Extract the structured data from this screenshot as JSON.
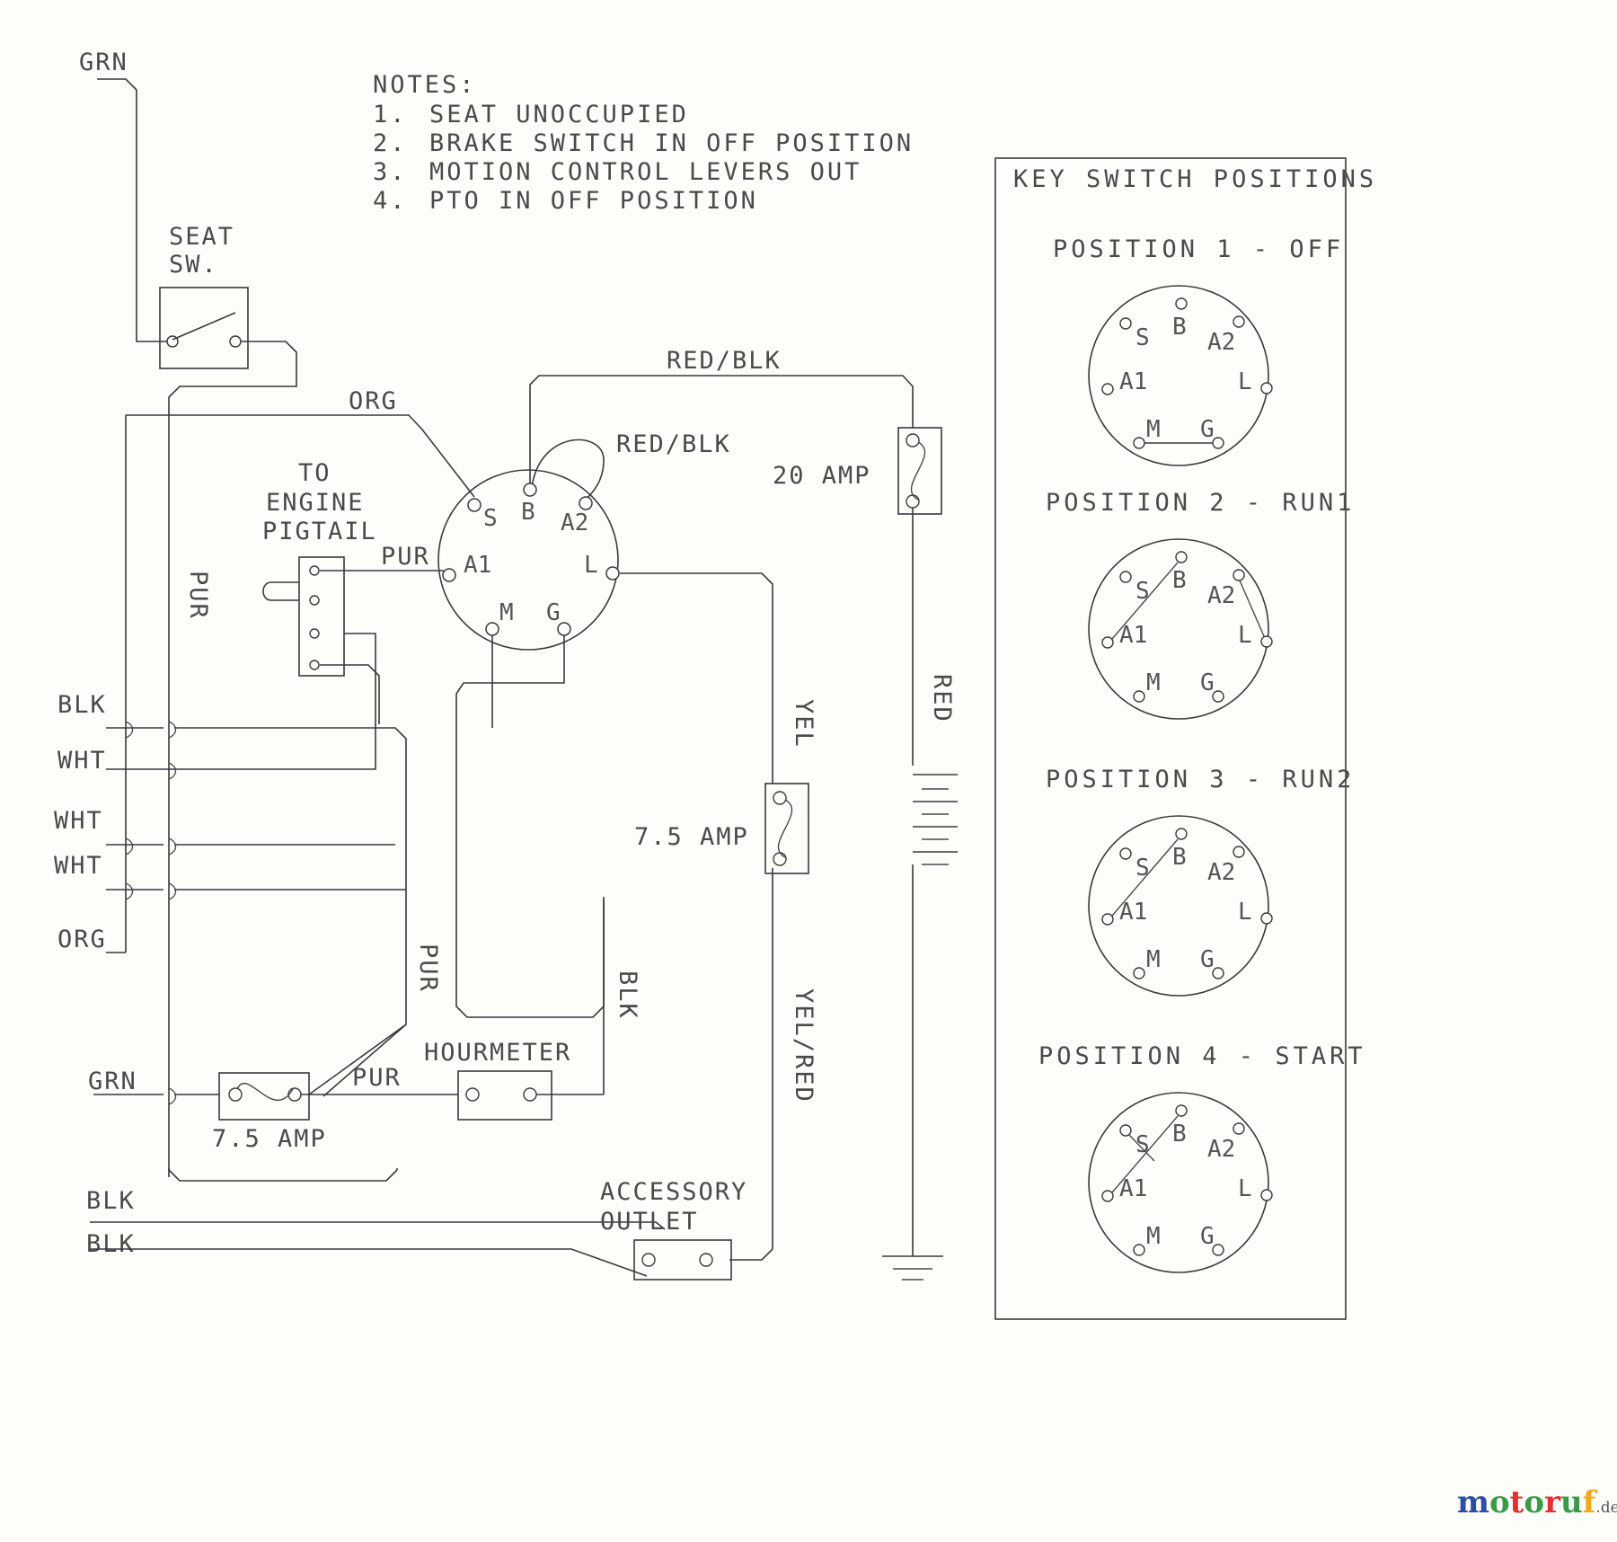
{
  "diagram": {
    "title": "Riding mower electrical wiring diagram",
    "notes": {
      "heading": "NOTES:",
      "items": [
        {
          "num": "1.",
          "text": "SEAT UNOCCUPIED"
        },
        {
          "num": "2.",
          "text": "BRAKE SWITCH IN OFF POSITION"
        },
        {
          "num": "3.",
          "text": "MOTION CONTROL LEVERS OUT"
        },
        {
          "num": "4.",
          "text": "PTO IN OFF POSITION"
        }
      ]
    },
    "components": {
      "seat_switch": "SEAT\nSW.",
      "seat_switch_line1": "SEAT",
      "seat_switch_line2": "SW.",
      "engine_pigtail_line1": "TO",
      "engine_pigtail_line2": "ENGINE",
      "engine_pigtail_line3": "PIGTAIL",
      "fuse_20amp": "20 AMP",
      "fuse_75amp_right": "7.5 AMP",
      "fuse_75amp_bottom": "7.5  AMP",
      "hourmeter": "HOURMETER",
      "accessory_outlet_line1": "ACCESSORY",
      "accessory_outlet_line2": "OUTLET"
    },
    "ignition_terminals": [
      "S",
      "B",
      "A2",
      "A1",
      "L",
      "M",
      "G"
    ],
    "wire_labels": {
      "grn_top": "GRN",
      "org_top": "ORG",
      "redblk_top": "RED/BLK",
      "redblk_switch": "RED/BLK",
      "pur_left_vertical": "PUR",
      "pur_a1": "PUR",
      "pur_mid_vertical": "PUR",
      "pur_bottom": "PUR",
      "blk_1": "BLK",
      "wht_1": "WHT",
      "wht_2": "WHT",
      "wht_3": "WHT",
      "org_left": "ORG",
      "grn_bottom": "GRN",
      "blk_bottom_1": "BLK",
      "blk_bottom_2": "BLK",
      "blk_vertical": "BLK",
      "yel": "YEL",
      "yelred": "YEL/RED",
      "red": "RED"
    },
    "key_switch_panel": {
      "title": "KEY SWITCH POSITIONS",
      "positions": [
        {
          "label": "POSITION 1 - OFF",
          "terminals": [
            "S",
            "B",
            "A2",
            "A1",
            "L",
            "M",
            "G"
          ],
          "connections": [
            "M-G"
          ]
        },
        {
          "label": "POSITION 2 - RUN1",
          "terminals": [
            "S",
            "B",
            "A2",
            "A1",
            "L",
            "M",
            "G"
          ],
          "connections": [
            "B-A1",
            "A2-L"
          ]
        },
        {
          "label": "POSITION 3 - RUN2",
          "terminals": [
            "S",
            "B",
            "A2",
            "A1",
            "L",
            "M",
            "G"
          ],
          "connections": [
            "B-A1"
          ]
        },
        {
          "label": "POSITION 4 - START",
          "terminals": [
            "S",
            "B",
            "A2",
            "A1",
            "L",
            "M",
            "G"
          ],
          "connections": [
            "B-A1",
            "S-to-B-A1-line"
          ]
        }
      ]
    },
    "watermark": {
      "text_parts": [
        {
          "ch": "m",
          "color": "#2c4f9e"
        },
        {
          "ch": "o",
          "color": "#3a9b47"
        },
        {
          "ch": "t",
          "color": "#e03030"
        },
        {
          "ch": "o",
          "color": "#3a9b47"
        },
        {
          "ch": "r",
          "color": "#e03030"
        },
        {
          "ch": "u",
          "color": "#3a9b47"
        },
        {
          "ch": "f",
          "color": "#f0a81e"
        }
      ],
      "suffix": ".de"
    }
  }
}
